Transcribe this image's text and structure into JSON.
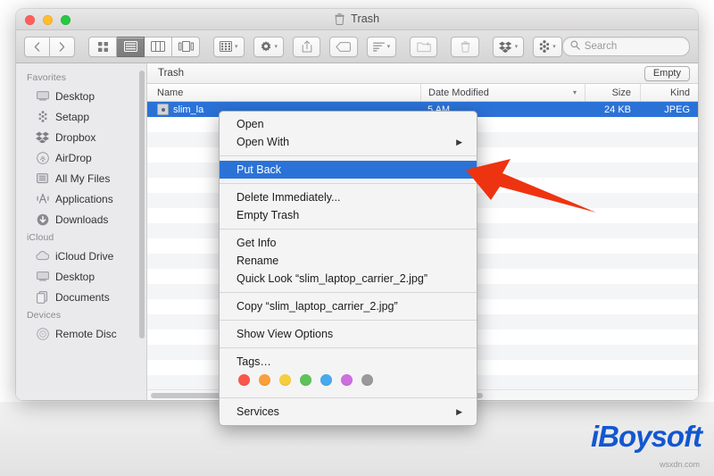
{
  "window": {
    "title": "Trash",
    "title_icon": "trash-icon",
    "traffic_lights": [
      "close",
      "minimize",
      "maximize"
    ]
  },
  "toolbar": {
    "back_label": "‹",
    "forward_label": "›",
    "view_modes": [
      {
        "name": "icon-view",
        "glyph": "grid"
      },
      {
        "name": "list-view",
        "glyph": "list",
        "active": true
      },
      {
        "name": "column-view",
        "glyph": "columns"
      },
      {
        "name": "gallery-view",
        "glyph": "gallery"
      }
    ],
    "group_button": "group-icon",
    "action_button": "gear-icon",
    "share_button": "share-icon",
    "tag_button": "tag-icon",
    "arrange_button": "arrange-icon",
    "newfolder_button": "new-folder-icon",
    "delete_button": "delete-icon",
    "dropbox_button": "dropbox-icon",
    "setapp_button": "setapp-icon",
    "chevron": "▾"
  },
  "search": {
    "placeholder": "Search",
    "icon": "search-icon",
    "value": ""
  },
  "sidebar": {
    "sections": [
      {
        "header": "Favorites",
        "items": [
          {
            "label": "Desktop",
            "icon": "desktop-icon"
          },
          {
            "label": "Setapp",
            "icon": "setapp-icon"
          },
          {
            "label": "Dropbox",
            "icon": "dropbox-icon"
          },
          {
            "label": "AirDrop",
            "icon": "airdrop-icon"
          },
          {
            "label": "All My Files",
            "icon": "all-my-files-icon"
          },
          {
            "label": "Applications",
            "icon": "applications-icon"
          },
          {
            "label": "Downloads",
            "icon": "downloads-icon"
          }
        ]
      },
      {
        "header": "iCloud",
        "items": [
          {
            "label": "iCloud Drive",
            "icon": "icloud-icon"
          },
          {
            "label": "Desktop",
            "icon": "desktop-icon"
          },
          {
            "label": "Documents",
            "icon": "documents-icon"
          }
        ]
      },
      {
        "header": "Devices",
        "items": [
          {
            "label": "Remote Disc",
            "icon": "disc-icon"
          }
        ]
      }
    ]
  },
  "path_bar": {
    "label": "Trash",
    "empty_button": "Empty"
  },
  "file_list": {
    "columns": [
      "Name",
      "Date Modified",
      "Size",
      "Kind"
    ],
    "sort_chevron": "▾",
    "rows": [
      {
        "name": "slim_la",
        "date_modified": "5 AM",
        "size": "24 KB",
        "kind": "JPEG",
        "selected": true,
        "icon": "jpeg-file-icon"
      }
    ],
    "empty_row_count": 18
  },
  "context_menu": {
    "groups": [
      [
        {
          "label": "Open",
          "submenu": false
        },
        {
          "label": "Open With",
          "submenu": true
        }
      ],
      [
        {
          "label": "Put Back",
          "submenu": false,
          "highlighted": true
        }
      ],
      [
        {
          "label": "Delete Immediately...",
          "submenu": false
        },
        {
          "label": "Empty Trash",
          "submenu": false
        }
      ],
      [
        {
          "label": "Get Info",
          "submenu": false
        },
        {
          "label": "Rename",
          "submenu": false
        },
        {
          "label": "Quick Look “slim_laptop_carrier_2.jpg”",
          "submenu": false
        }
      ],
      [
        {
          "label": "Copy “slim_laptop_carrier_2.jpg”",
          "submenu": false
        }
      ],
      [
        {
          "label": "Show View Options",
          "submenu": false
        }
      ],
      [
        {
          "label": "Tags…",
          "submenu": false
        }
      ],
      [
        {
          "label": "Services",
          "submenu": true
        }
      ]
    ],
    "tag_colors": [
      "#f9584b",
      "#f9a03a",
      "#f5ce3e",
      "#5ec35a",
      "#47a9f0",
      "#cd6fe0",
      "#9a9a9a"
    ],
    "submenu_arrow": "▶",
    "highlight_color": "#2b72d7"
  },
  "annotation": {
    "arrow_color": "#ee3310",
    "name": "put-back-pointer-arrow"
  },
  "watermark": {
    "brand": "iBoysoft",
    "brand_color": "#1357d0",
    "source": "wsxdn.com"
  }
}
